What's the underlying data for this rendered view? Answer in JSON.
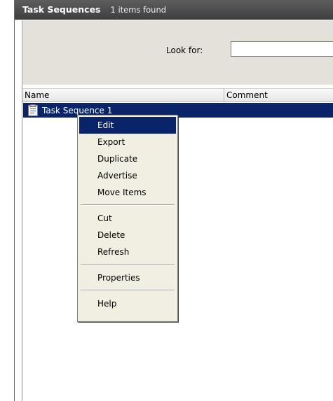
{
  "titlebar": {
    "title": "Task Sequences",
    "count": "1 items found"
  },
  "search": {
    "label": "Look for:",
    "value": ""
  },
  "list": {
    "columns": [
      {
        "label": "Name"
      },
      {
        "label": "Comment"
      }
    ],
    "rows": [
      {
        "name": "Task Sequence 1",
        "comment": "",
        "icon": "task-sequence-icon"
      }
    ]
  },
  "context_menu": {
    "items": [
      {
        "label": "Edit",
        "highlighted": true
      },
      {
        "label": "Export"
      },
      {
        "label": "Duplicate"
      },
      {
        "label": "Advertise"
      },
      {
        "label": "Move Items"
      },
      {
        "label": "Cut"
      },
      {
        "label": "Delete"
      },
      {
        "label": "Refresh"
      },
      {
        "label": "Properties"
      },
      {
        "label": "Help"
      }
    ]
  },
  "colors": {
    "selection": "#0a246a",
    "panel": "#e3e1da",
    "menu_bg": "#f1efe2"
  }
}
